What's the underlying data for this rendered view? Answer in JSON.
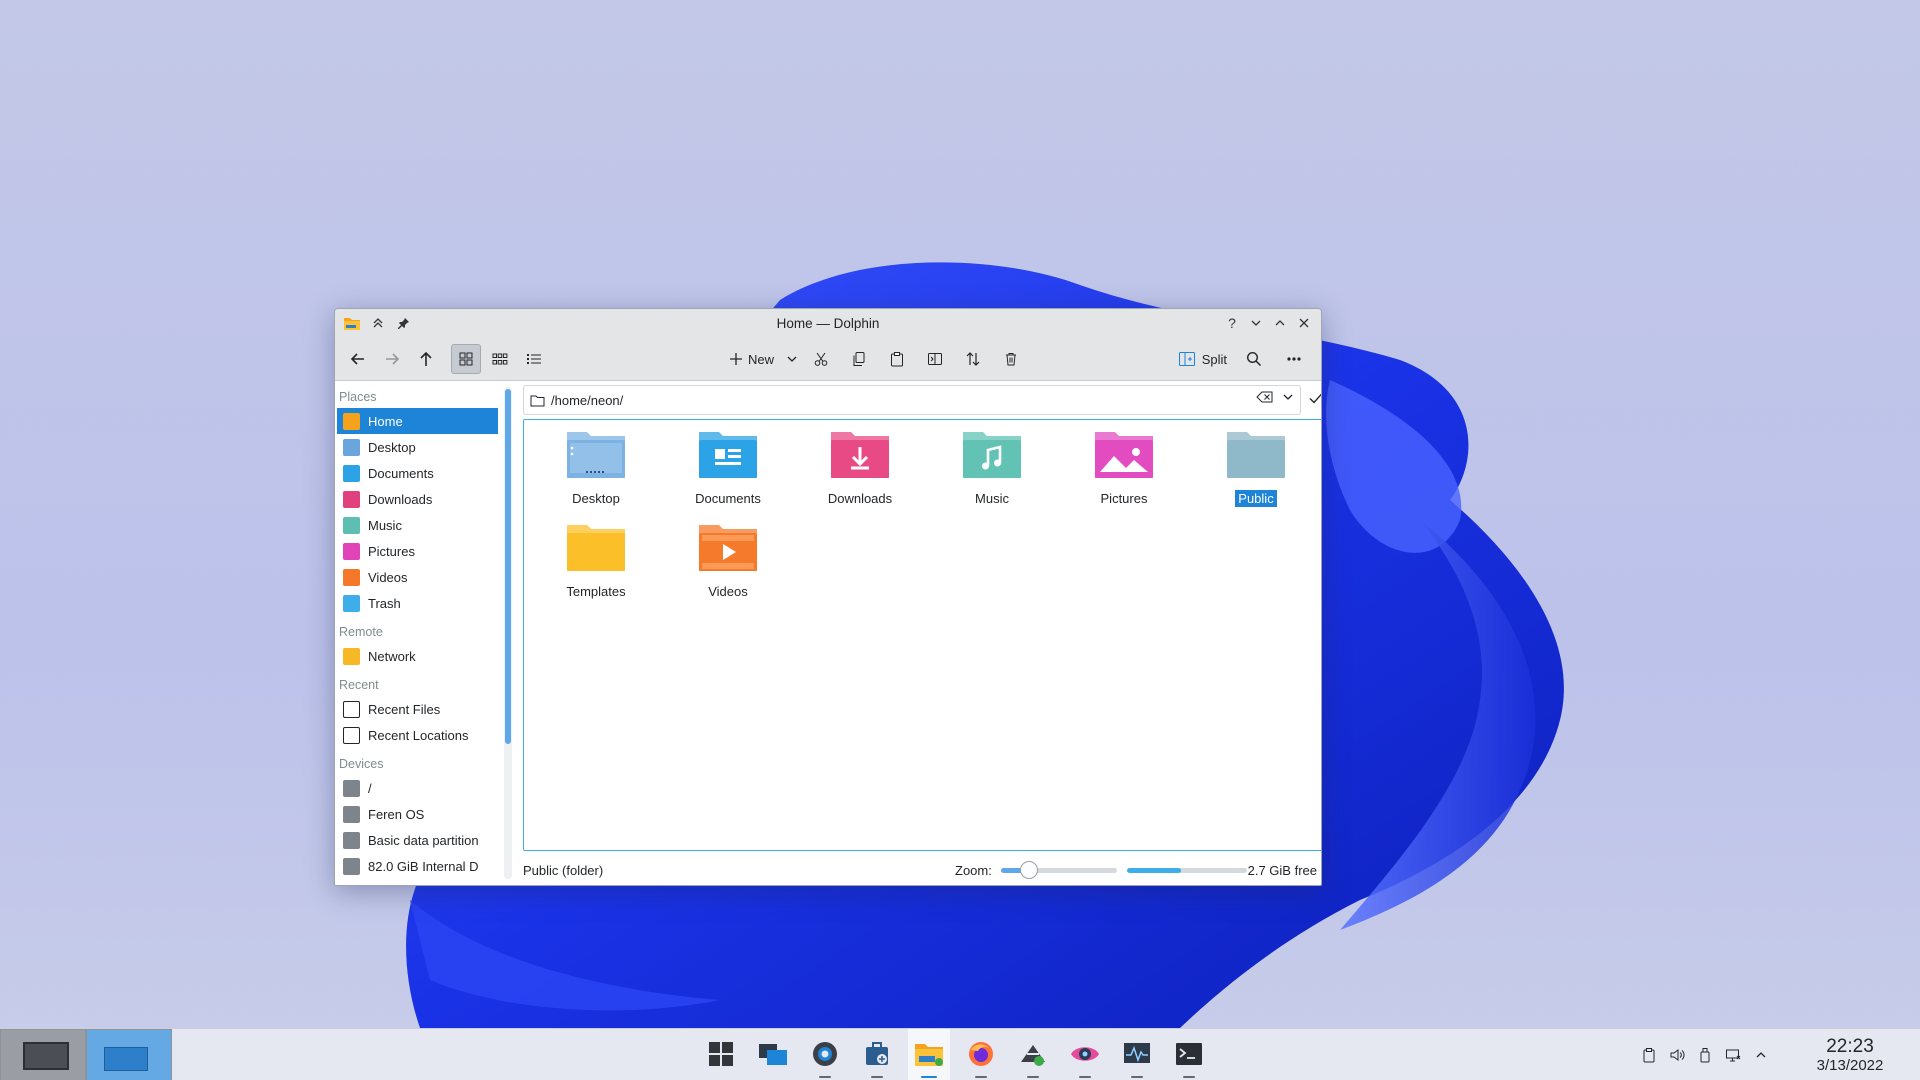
{
  "window": {
    "title": "Home — Dolphin",
    "controls": {
      "help": "?",
      "minimize": "minimize",
      "maximize": "maximize",
      "close": "close"
    }
  },
  "toolbar": {
    "new_label": "New",
    "split_label": "Split"
  },
  "location": {
    "path": "/home/neon/"
  },
  "sidebar": {
    "sections": [
      {
        "heading": "Places",
        "items": [
          {
            "label": "Home",
            "icon": "home-icon",
            "color": "#f6a21a",
            "selected": true
          },
          {
            "label": "Desktop",
            "icon": "desktop-icon",
            "color": "#6aa6dc"
          },
          {
            "label": "Documents",
            "icon": "documents-icon",
            "color": "#2ba3e6"
          },
          {
            "label": "Downloads",
            "icon": "downloads-icon",
            "color": "#e0407c"
          },
          {
            "label": "Music",
            "icon": "music-icon",
            "color": "#5cbfb2"
          },
          {
            "label": "Pictures",
            "icon": "pictures-icon",
            "color": "#e044b8"
          },
          {
            "label": "Videos",
            "icon": "videos-icon",
            "color": "#f5782a"
          },
          {
            "label": "Trash",
            "icon": "trash-icon",
            "color": "#3daee9"
          }
        ]
      },
      {
        "heading": "Remote",
        "items": [
          {
            "label": "Network",
            "icon": "network-folder-icon",
            "color": "#f8b826"
          }
        ]
      },
      {
        "heading": "Recent",
        "items": [
          {
            "label": "Recent Files",
            "icon": "recent-files-icon",
            "color": "#ffffff"
          },
          {
            "label": "Recent Locations",
            "icon": "recent-locations-icon",
            "color": "#ffffff"
          }
        ]
      },
      {
        "heading": "Devices",
        "items": [
          {
            "label": "/",
            "icon": "drive-icon",
            "color": "#7d848b"
          },
          {
            "label": "Feren OS",
            "icon": "drive-icon",
            "color": "#7d848b"
          },
          {
            "label": "Basic data partition",
            "icon": "drive-icon",
            "color": "#7d848b"
          },
          {
            "label": "82.0 GiB Internal D",
            "icon": "drive-icon",
            "color": "#7d848b"
          }
        ]
      }
    ]
  },
  "files": [
    {
      "name": "Desktop",
      "icon": "desktop-folder-icon",
      "color": "#7db3e4"
    },
    {
      "name": "Documents",
      "icon": "documents-folder-icon",
      "color": "#2ba3e6"
    },
    {
      "name": "Downloads",
      "icon": "downloads-folder-icon",
      "color": "#e84a86"
    },
    {
      "name": "Music",
      "icon": "music-folder-icon",
      "color": "#62c3b5"
    },
    {
      "name": "Pictures",
      "icon": "pictures-folder-icon",
      "color": "#e34cc0"
    },
    {
      "name": "Public",
      "icon": "public-folder-icon",
      "color": "#8fb8c8",
      "selected": true
    },
    {
      "name": "Templates",
      "icon": "templates-folder-icon",
      "color": "#fbbf2a"
    },
    {
      "name": "Videos",
      "icon": "videos-folder-icon",
      "color": "#f57a2c"
    }
  ],
  "status": {
    "text": "Public (folder)",
    "zoom_label": "Zoom:",
    "zoom_level": 0.24,
    "space_used_fraction": 0.45,
    "free_text": "2.7 GiB free"
  },
  "taskbar": {
    "apps": [
      {
        "name": "application-launcher-icon",
        "active": false
      },
      {
        "name": "overview-icon",
        "active": false
      },
      {
        "name": "system-settings-icon",
        "active": false
      },
      {
        "name": "discover-icon",
        "active": false
      },
      {
        "name": "dolphin-icon",
        "active": true
      },
      {
        "name": "firefox-icon",
        "active": false
      },
      {
        "name": "store-icon",
        "active": false
      },
      {
        "name": "eye-icon",
        "active": false
      },
      {
        "name": "system-monitor-icon",
        "active": false
      },
      {
        "name": "terminal-icon",
        "active": false
      }
    ],
    "clock": {
      "time": "22:23",
      "date": "3/13/2022"
    }
  },
  "colors": {
    "accent": "#1d84d8",
    "focus": "#3daee9",
    "wallpaper_blob": "#1f3ff0"
  }
}
